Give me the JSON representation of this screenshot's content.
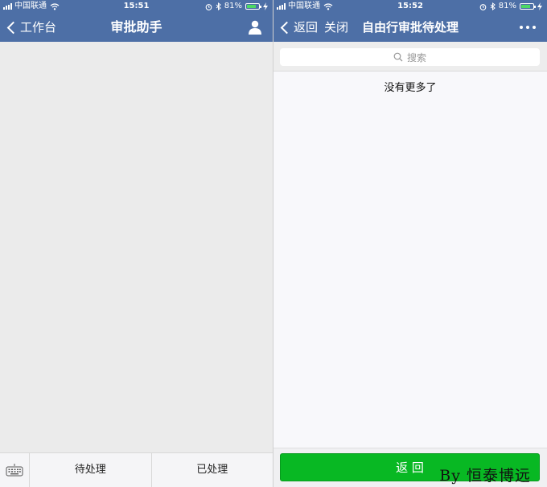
{
  "left": {
    "status": {
      "carrier": "中国联通",
      "time": "15:51",
      "battery": "81%",
      "battery_level": 0.81
    },
    "nav": {
      "back_label": "工作台",
      "title": "审批助手"
    },
    "tabs": [
      {
        "label": "待处理"
      },
      {
        "label": "已处理"
      }
    ]
  },
  "right": {
    "status": {
      "carrier": "中国联通",
      "time": "15:52",
      "battery": "81%",
      "battery_level": 0.81
    },
    "nav": {
      "back_label": "返回",
      "close_label": "关闭",
      "title": "自由行审批待处理"
    },
    "search": {
      "placeholder": "搜索"
    },
    "empty_text": "没有更多了",
    "return_button": "返 回"
  },
  "watermark": "By 恒泰博远",
  "colors": {
    "nav_bg": "#4d6fa6",
    "button_green": "#08b823",
    "battery_green": "#4cd964"
  }
}
